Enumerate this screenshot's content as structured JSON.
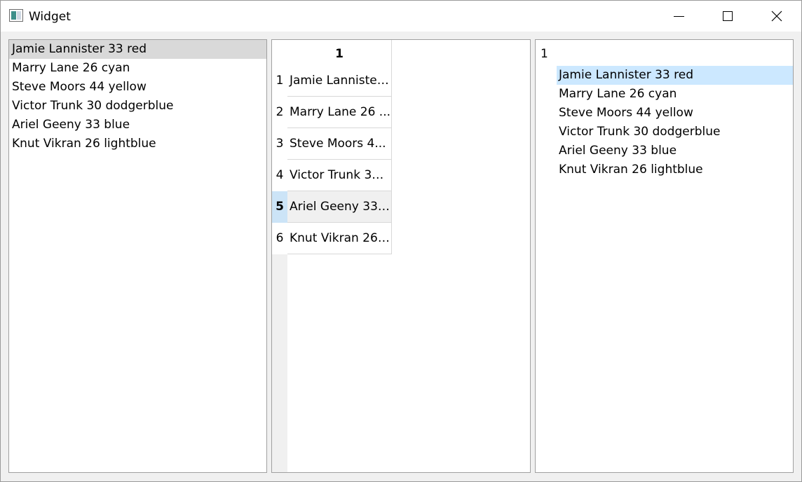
{
  "window": {
    "title": "Widget",
    "icon": "app-window-icon"
  },
  "left_list": {
    "items": [
      "Jamie Lannister 33 red",
      "Marry Lane 26 cyan",
      "Steve Moors 44 yellow",
      "Victor Trunk 30 dodgerblue",
      "Ariel Geeny 33 blue",
      "Knut Vikran 26 lightblue"
    ],
    "selected_index": 0
  },
  "table": {
    "column_header": "1",
    "row_numbers": [
      "1",
      "2",
      "3",
      "4",
      "5",
      "6"
    ],
    "cells": [
      "Jamie Lannister ...",
      "Marry Lane 26 ...",
      "Steve Moors 4...",
      "Victor Trunk 30 ...",
      "Ariel Geeny 33 ...",
      "Knut Vikran 26 ..."
    ],
    "current_row_index": 4
  },
  "tree": {
    "root_label": "1",
    "items": [
      "Jamie Lannister 33 red",
      "Marry Lane 26 cyan",
      "Steve Moors 44 yellow",
      "Victor Trunk 30 dodgerblue",
      "Ariel Geeny 33 blue",
      "Knut Vikran 26 lightblue"
    ],
    "selected_index": 0
  },
  "colors": {
    "list_selection": "#d9d9d9",
    "tree_selection": "#cce8ff",
    "table_current_header": "#cce4f7",
    "table_current_cell": "#f0f0f0"
  }
}
